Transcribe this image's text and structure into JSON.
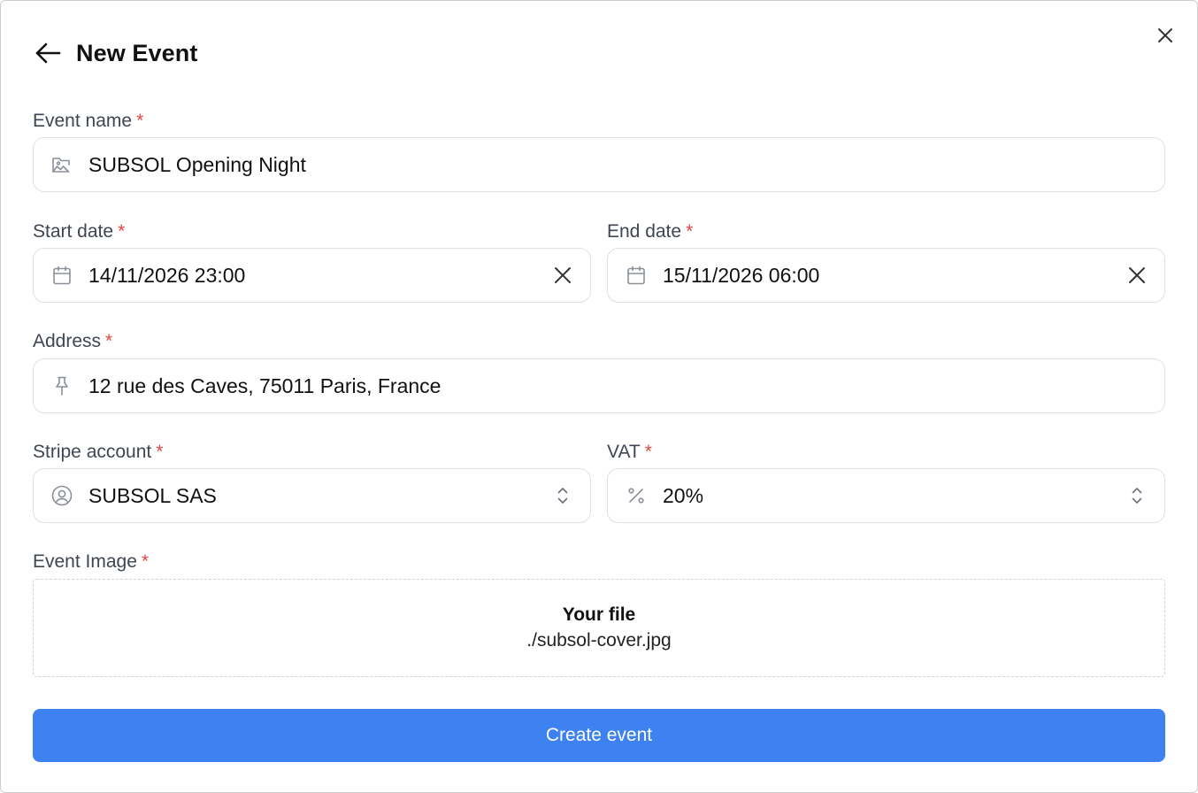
{
  "header": {
    "title": "New Event",
    "back_icon": "arrow-left-icon",
    "close_icon": "close-icon"
  },
  "form": {
    "required_mark": "*",
    "event_name": {
      "label": "Event name",
      "value": "SUBSOL Opening Night",
      "icon": "image-icon"
    },
    "start_date": {
      "label": "Start date",
      "value": "14/11/2026 23:00",
      "icon": "calendar-icon",
      "clear_icon": "clear-icon"
    },
    "end_date": {
      "label": "End date",
      "value": "15/11/2026 06:00",
      "icon": "calendar-icon",
      "clear_icon": "clear-icon"
    },
    "address": {
      "label": "Address",
      "value": "12 rue des Caves, 75011 Paris, France",
      "icon": "pin-icon"
    },
    "stripe_account": {
      "label": "Stripe account",
      "value": "SUBSOL SAS",
      "icon": "user-circle-icon",
      "chevron_icon": "chevron-up-down-icon"
    },
    "vat": {
      "label": "VAT",
      "value": "20%",
      "icon": "percent-icon",
      "chevron_icon": "chevron-up-down-icon"
    },
    "event_image": {
      "label": "Event Image",
      "file_title": "Your file",
      "file_name": "./subsol-cover.jpg"
    },
    "submit_label": "Create event"
  },
  "colors": {
    "accent": "#3e82f1",
    "required": "#e0463f",
    "border": "#dde0e4",
    "label": "#3f4653",
    "icon": "#8a9099"
  }
}
